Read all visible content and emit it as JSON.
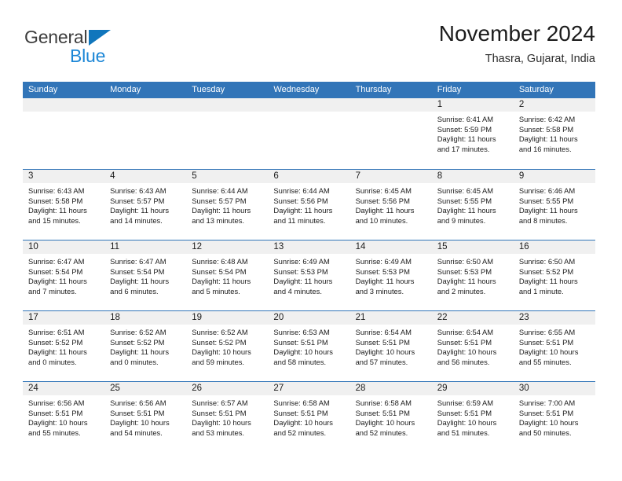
{
  "logo": {
    "word_one": "General",
    "word_two": "Blue",
    "triangle": "triangle-icon"
  },
  "header": {
    "title": "November 2024",
    "subtitle": "Thasra, Gujarat, India"
  },
  "colors": {
    "header_blue": "#3275b8",
    "logo_blue": "#1b86d6",
    "band_gray": "#f0f0f0"
  },
  "labels": {
    "sunrise_prefix": "Sunrise:",
    "sunset_prefix": "Sunset:",
    "daylight_prefix": "Daylight:"
  },
  "weekdays": [
    "Sunday",
    "Monday",
    "Tuesday",
    "Wednesday",
    "Thursday",
    "Friday",
    "Saturday"
  ],
  "weeks": [
    [
      {
        "date": "",
        "sunrise": "",
        "sunset": "",
        "daylight": ""
      },
      {
        "date": "",
        "sunrise": "",
        "sunset": "",
        "daylight": ""
      },
      {
        "date": "",
        "sunrise": "",
        "sunset": "",
        "daylight": ""
      },
      {
        "date": "",
        "sunrise": "",
        "sunset": "",
        "daylight": ""
      },
      {
        "date": "",
        "sunrise": "",
        "sunset": "",
        "daylight": ""
      },
      {
        "date": "1",
        "sunrise": "Sunrise: 6:41 AM",
        "sunset": "Sunset: 5:59 PM",
        "daylight": "Daylight: 11 hours and 17 minutes."
      },
      {
        "date": "2",
        "sunrise": "Sunrise: 6:42 AM",
        "sunset": "Sunset: 5:58 PM",
        "daylight": "Daylight: 11 hours and 16 minutes."
      }
    ],
    [
      {
        "date": "3",
        "sunrise": "Sunrise: 6:43 AM",
        "sunset": "Sunset: 5:58 PM",
        "daylight": "Daylight: 11 hours and 15 minutes."
      },
      {
        "date": "4",
        "sunrise": "Sunrise: 6:43 AM",
        "sunset": "Sunset: 5:57 PM",
        "daylight": "Daylight: 11 hours and 14 minutes."
      },
      {
        "date": "5",
        "sunrise": "Sunrise: 6:44 AM",
        "sunset": "Sunset: 5:57 PM",
        "daylight": "Daylight: 11 hours and 13 minutes."
      },
      {
        "date": "6",
        "sunrise": "Sunrise: 6:44 AM",
        "sunset": "Sunset: 5:56 PM",
        "daylight": "Daylight: 11 hours and 11 minutes."
      },
      {
        "date": "7",
        "sunrise": "Sunrise: 6:45 AM",
        "sunset": "Sunset: 5:56 PM",
        "daylight": "Daylight: 11 hours and 10 minutes."
      },
      {
        "date": "8",
        "sunrise": "Sunrise: 6:45 AM",
        "sunset": "Sunset: 5:55 PM",
        "daylight": "Daylight: 11 hours and 9 minutes."
      },
      {
        "date": "9",
        "sunrise": "Sunrise: 6:46 AM",
        "sunset": "Sunset: 5:55 PM",
        "daylight": "Daylight: 11 hours and 8 minutes."
      }
    ],
    [
      {
        "date": "10",
        "sunrise": "Sunrise: 6:47 AM",
        "sunset": "Sunset: 5:54 PM",
        "daylight": "Daylight: 11 hours and 7 minutes."
      },
      {
        "date": "11",
        "sunrise": "Sunrise: 6:47 AM",
        "sunset": "Sunset: 5:54 PM",
        "daylight": "Daylight: 11 hours and 6 minutes."
      },
      {
        "date": "12",
        "sunrise": "Sunrise: 6:48 AM",
        "sunset": "Sunset: 5:54 PM",
        "daylight": "Daylight: 11 hours and 5 minutes."
      },
      {
        "date": "13",
        "sunrise": "Sunrise: 6:49 AM",
        "sunset": "Sunset: 5:53 PM",
        "daylight": "Daylight: 11 hours and 4 minutes."
      },
      {
        "date": "14",
        "sunrise": "Sunrise: 6:49 AM",
        "sunset": "Sunset: 5:53 PM",
        "daylight": "Daylight: 11 hours and 3 minutes."
      },
      {
        "date": "15",
        "sunrise": "Sunrise: 6:50 AM",
        "sunset": "Sunset: 5:53 PM",
        "daylight": "Daylight: 11 hours and 2 minutes."
      },
      {
        "date": "16",
        "sunrise": "Sunrise: 6:50 AM",
        "sunset": "Sunset: 5:52 PM",
        "daylight": "Daylight: 11 hours and 1 minute."
      }
    ],
    [
      {
        "date": "17",
        "sunrise": "Sunrise: 6:51 AM",
        "sunset": "Sunset: 5:52 PM",
        "daylight": "Daylight: 11 hours and 0 minutes."
      },
      {
        "date": "18",
        "sunrise": "Sunrise: 6:52 AM",
        "sunset": "Sunset: 5:52 PM",
        "daylight": "Daylight: 11 hours and 0 minutes."
      },
      {
        "date": "19",
        "sunrise": "Sunrise: 6:52 AM",
        "sunset": "Sunset: 5:52 PM",
        "daylight": "Daylight: 10 hours and 59 minutes."
      },
      {
        "date": "20",
        "sunrise": "Sunrise: 6:53 AM",
        "sunset": "Sunset: 5:51 PM",
        "daylight": "Daylight: 10 hours and 58 minutes."
      },
      {
        "date": "21",
        "sunrise": "Sunrise: 6:54 AM",
        "sunset": "Sunset: 5:51 PM",
        "daylight": "Daylight: 10 hours and 57 minutes."
      },
      {
        "date": "22",
        "sunrise": "Sunrise: 6:54 AM",
        "sunset": "Sunset: 5:51 PM",
        "daylight": "Daylight: 10 hours and 56 minutes."
      },
      {
        "date": "23",
        "sunrise": "Sunrise: 6:55 AM",
        "sunset": "Sunset: 5:51 PM",
        "daylight": "Daylight: 10 hours and 55 minutes."
      }
    ],
    [
      {
        "date": "24",
        "sunrise": "Sunrise: 6:56 AM",
        "sunset": "Sunset: 5:51 PM",
        "daylight": "Daylight: 10 hours and 55 minutes."
      },
      {
        "date": "25",
        "sunrise": "Sunrise: 6:56 AM",
        "sunset": "Sunset: 5:51 PM",
        "daylight": "Daylight: 10 hours and 54 minutes."
      },
      {
        "date": "26",
        "sunrise": "Sunrise: 6:57 AM",
        "sunset": "Sunset: 5:51 PM",
        "daylight": "Daylight: 10 hours and 53 minutes."
      },
      {
        "date": "27",
        "sunrise": "Sunrise: 6:58 AM",
        "sunset": "Sunset: 5:51 PM",
        "daylight": "Daylight: 10 hours and 52 minutes."
      },
      {
        "date": "28",
        "sunrise": "Sunrise: 6:58 AM",
        "sunset": "Sunset: 5:51 PM",
        "daylight": "Daylight: 10 hours and 52 minutes."
      },
      {
        "date": "29",
        "sunrise": "Sunrise: 6:59 AM",
        "sunset": "Sunset: 5:51 PM",
        "daylight": "Daylight: 10 hours and 51 minutes."
      },
      {
        "date": "30",
        "sunrise": "Sunrise: 7:00 AM",
        "sunset": "Sunset: 5:51 PM",
        "daylight": "Daylight: 10 hours and 50 minutes."
      }
    ]
  ]
}
